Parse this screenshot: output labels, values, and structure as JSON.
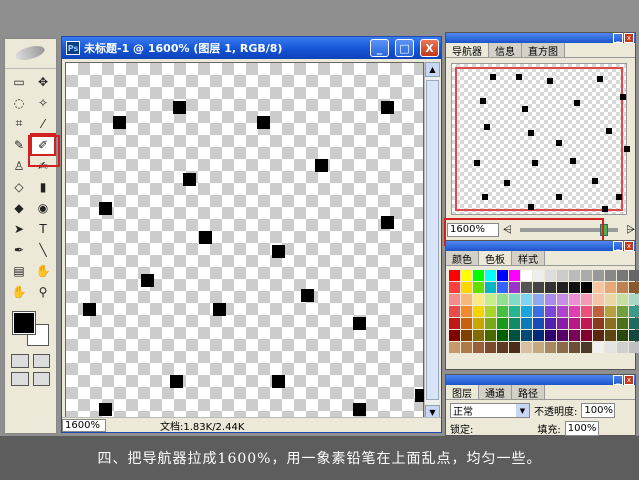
{
  "document": {
    "title": "未标题-1 @ 1600% (图层 1, RGB/8)",
    "zoom": "1600%",
    "doc_info": "文档:1.83K/2.44K",
    "window_buttons": [
      "_",
      "□",
      "X"
    ]
  },
  "navigator": {
    "tabs": [
      "导航器",
      "信息",
      "直方图"
    ],
    "zoom": "1600%"
  },
  "color_panel": {
    "tabs": [
      "颜色",
      "色板",
      "样式"
    ]
  },
  "layers_panel": {
    "tabs": [
      "图层",
      "通道",
      "路径"
    ],
    "blend_mode": "正常",
    "opacity_label": "不透明度:",
    "opacity_value": "100%",
    "lock_label": "锁定:",
    "fill_label": "填充:",
    "fill_value": "100%"
  },
  "toolbox": {
    "tools": [
      "▭",
      "✥",
      "◌",
      "✧",
      "⌗",
      "⁄",
      "✎",
      "✐",
      "♙",
      "✍",
      "◇",
      "▮",
      "◆",
      "◉",
      "➤",
      "T",
      "✒",
      "╲",
      "▤",
      "✋",
      "✋",
      "⚲"
    ],
    "selected_index": 7
  },
  "caption": "四、把导航器拉成1600%，用一象素铅笔在上面乱点，均匀一些。",
  "canvas_pixels": "scattered black pixels on transparent checkerboard"
}
